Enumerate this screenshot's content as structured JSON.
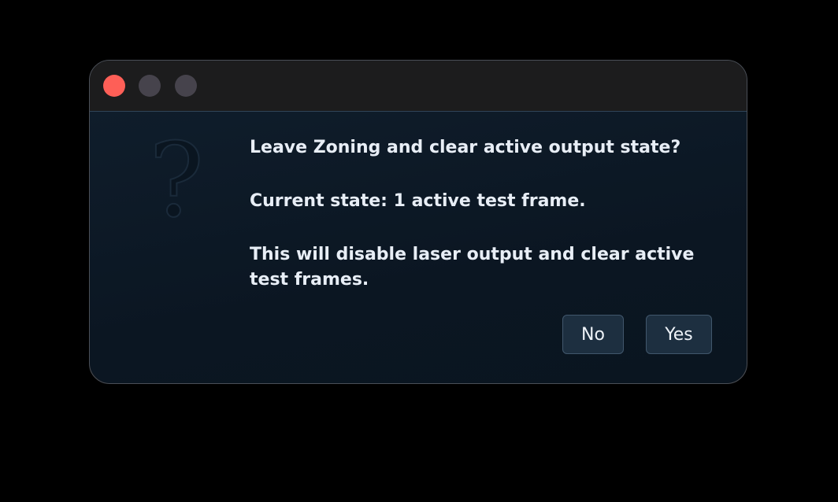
{
  "dialog": {
    "lines": [
      "Leave Zoning and clear active output state?",
      "Current state: 1 active test frame.",
      "This will disable laser output and clear active test frames."
    ],
    "buttons": {
      "no": "No",
      "yes": "Yes"
    },
    "icon": "question-icon"
  },
  "colors": {
    "close": "#fe5f57",
    "inactive_traffic": "#46434c",
    "dialog_background": "#0d1a27",
    "button_background": "#1d2f40",
    "text": "#e8eef6"
  }
}
